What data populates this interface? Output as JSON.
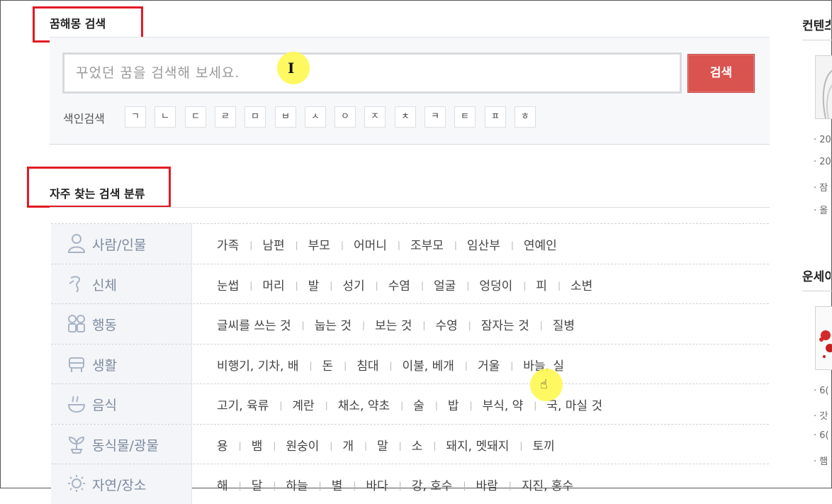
{
  "search": {
    "title": "꿈해몽 검색",
    "placeholder": "꾸었던 꿈을 검색해 보세요.",
    "button_label": "검색",
    "index_label": "색인검색",
    "index_keys": [
      "ㄱ",
      "ㄴ",
      "ㄷ",
      "ㄹ",
      "ㅁ",
      "ㅂ",
      "ㅅ",
      "ㅇ",
      "ㅈ",
      "ㅊ",
      "ㅋ",
      "ㅌ",
      "ㅍ",
      "ㅎ"
    ]
  },
  "categories": {
    "title": "자주 찾는 검색 분류",
    "rows": [
      {
        "name": "사람/인물",
        "icon": "person-icon",
        "items": [
          "가족",
          "남편",
          "부모",
          "어머니",
          "조부모",
          "임산부",
          "연예인"
        ]
      },
      {
        "name": "신체",
        "icon": "body-icon",
        "items": [
          "눈썹",
          "머리",
          "발",
          "성기",
          "수염",
          "얼굴",
          "엉덩이",
          "피",
          "소변"
        ]
      },
      {
        "name": "행동",
        "icon": "action-icon",
        "items": [
          "글씨를 쓰는 것",
          "눕는 것",
          "보는 것",
          "수영",
          "잠자는 것",
          "질병"
        ]
      },
      {
        "name": "생활",
        "icon": "vehicle-icon",
        "items": [
          "비행기, 기차, 배",
          "돈",
          "침대",
          "이불, 베개",
          "거울",
          "바늘, 실"
        ]
      },
      {
        "name": "음식",
        "icon": "food-icon",
        "items": [
          "고기, 육류",
          "계란",
          "채소, 약초",
          "술",
          "밥",
          "부식, 약",
          "국, 마실 것"
        ]
      },
      {
        "name": "동식물/광물",
        "icon": "plant-icon",
        "items": [
          "용",
          "뱀",
          "원숭이",
          "개",
          "말",
          "소",
          "돼지, 멧돼지",
          "토끼"
        ]
      },
      {
        "name": "자연/장소",
        "icon": "nature-icon",
        "items": [
          "해",
          "달",
          "하늘",
          "별",
          "바다",
          "강, 호수",
          "바람",
          "지진, 홍수"
        ]
      }
    ]
  },
  "rail": {
    "content_title": "컨텐츠",
    "content_lines": [
      "20",
      "20",
      "잠",
      "올\n니"
    ],
    "fortune_title": "운세이",
    "fortune_lines": [
      "6(",
      "갓",
      "6(",
      "햄"
    ]
  },
  "colors": {
    "accent_red": "#d9534f",
    "highlight_box": "#e21a24",
    "category_label": "#7c8ba0"
  }
}
